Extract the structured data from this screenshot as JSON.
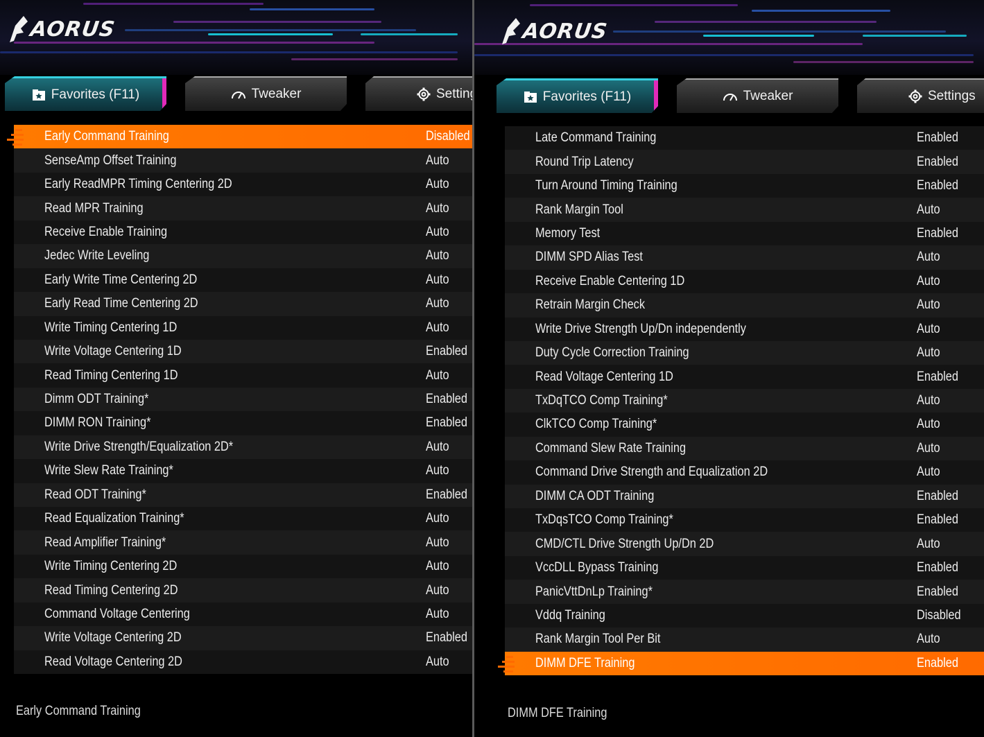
{
  "brand": "AORUS",
  "tabs": {
    "favorites": "Favorites (F11)",
    "tweaker": "Tweaker",
    "settings_left": "Setting",
    "settings_right": "Settings"
  },
  "colors": {
    "selected_row": "#ff6a00",
    "favorites_tab": "#1d6f7a",
    "favorites_accent": "#e22ab9"
  },
  "left": {
    "rows": [
      {
        "label": "Early Command Training",
        "value": "Disabled",
        "selected": true
      },
      {
        "label": "SenseAmp Offset Training",
        "value": "Auto"
      },
      {
        "label": "Early ReadMPR Timing Centering 2D",
        "value": "Auto"
      },
      {
        "label": "Read MPR Training",
        "value": "Auto"
      },
      {
        "label": "Receive Enable Training",
        "value": "Auto"
      },
      {
        "label": "Jedec Write Leveling",
        "value": "Auto"
      },
      {
        "label": "Early Write Time Centering 2D",
        "value": "Auto"
      },
      {
        "label": "Early Read Time Centering 2D",
        "value": "Auto"
      },
      {
        "label": "Write Timing Centering 1D",
        "value": "Auto"
      },
      {
        "label": "Write Voltage Centering 1D",
        "value": "Enabled"
      },
      {
        "label": "Read Timing Centering 1D",
        "value": "Auto"
      },
      {
        "label": "Dimm ODT Training*",
        "value": "Enabled"
      },
      {
        "label": "DIMM RON Training*",
        "value": "Enabled"
      },
      {
        "label": "Write Drive Strength/Equalization 2D*",
        "value": "Auto"
      },
      {
        "label": "Write Slew Rate Training*",
        "value": "Auto"
      },
      {
        "label": "Read ODT Training*",
        "value": "Enabled"
      },
      {
        "label": "Read Equalization Training*",
        "value": "Auto"
      },
      {
        "label": "Read Amplifier Training*",
        "value": "Auto"
      },
      {
        "label": "Write Timing Centering 2D",
        "value": "Auto"
      },
      {
        "label": "Read Timing Centering 2D",
        "value": "Auto"
      },
      {
        "label": "Command Voltage Centering",
        "value": "Auto"
      },
      {
        "label": "Write Voltage Centering 2D",
        "value": "Enabled"
      },
      {
        "label": "Read Voltage Centering 2D",
        "value": "Auto"
      }
    ],
    "description": "Early Command Training"
  },
  "right": {
    "rows": [
      {
        "label": "Late Command Training",
        "value": "Enabled"
      },
      {
        "label": "Round Trip Latency",
        "value": "Enabled"
      },
      {
        "label": "Turn Around Timing Training",
        "value": "Enabled"
      },
      {
        "label": "Rank Margin Tool",
        "value": "Auto"
      },
      {
        "label": "Memory Test",
        "value": "Enabled"
      },
      {
        "label": "DIMM SPD Alias Test",
        "value": "Auto"
      },
      {
        "label": "Receive Enable Centering 1D",
        "value": "Auto"
      },
      {
        "label": "Retrain Margin Check",
        "value": "Auto"
      },
      {
        "label": "Write Drive Strength Up/Dn independently",
        "value": "Auto"
      },
      {
        "label": "Duty Cycle Correction Training",
        "value": "Auto"
      },
      {
        "label": "Read Voltage Centering 1D",
        "value": "Enabled"
      },
      {
        "label": "TxDqTCO Comp Training*",
        "value": "Auto"
      },
      {
        "label": "ClkTCO Comp Training*",
        "value": "Auto"
      },
      {
        "label": "Command Slew Rate Training",
        "value": "Auto"
      },
      {
        "label": "Command Drive Strength and Equalization 2D",
        "value": "Auto"
      },
      {
        "label": "DIMM CA ODT Training",
        "value": "Enabled"
      },
      {
        "label": "TxDqsTCO Comp Training*",
        "value": "Enabled"
      },
      {
        "label": "CMD/CTL Drive Strength Up/Dn 2D",
        "value": "Auto"
      },
      {
        "label": "VccDLL Bypass Training",
        "value": "Enabled"
      },
      {
        "label": "PanicVttDnLp Training*",
        "value": "Enabled"
      },
      {
        "label": "Vddq Training",
        "value": "Disabled"
      },
      {
        "label": "Rank Margin Tool Per Bit",
        "value": "Auto"
      },
      {
        "label": "DIMM DFE Training",
        "value": "Enabled",
        "selected": true
      }
    ],
    "description": "DIMM DFE Training"
  }
}
